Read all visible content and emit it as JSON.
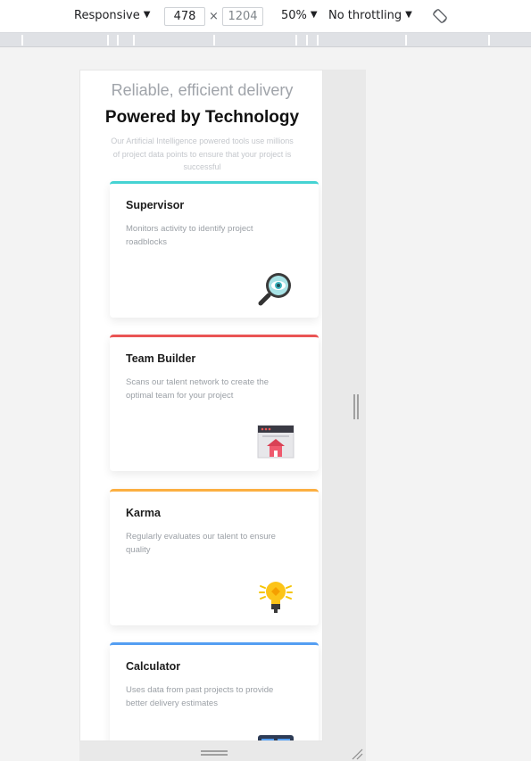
{
  "devtools": {
    "device_mode": "Responsive",
    "width": "478",
    "height": "1204",
    "times_symbol": "×",
    "zoom": "50%",
    "throttling": "No throttling",
    "caret": "▼"
  },
  "hero": {
    "subtitle": "Reliable, efficient delivery",
    "title": "Powered by Technology",
    "description": "Our Artificial Intelligence powered tools use millions of project data points to ensure that your project is successful"
  },
  "cards": [
    {
      "title": "Supervisor",
      "description": "Monitors activity to identify project roadblocks",
      "accent": "#45d3d3",
      "icon": "magnifier-eye-icon"
    },
    {
      "title": "Team Builder",
      "description": "Scans our talent network to create the optimal team for your project",
      "accent": "#ea5454",
      "icon": "browser-team-icon"
    },
    {
      "title": "Karma",
      "description": "Regularly evaluates our talent to ensure quality",
      "accent": "#fcaf41",
      "icon": "lightbulb-icon"
    },
    {
      "title": "Calculator",
      "description": "Uses data from past projects to provide better delivery estimates",
      "accent": "#549ef2",
      "icon": "calculator-icon"
    }
  ]
}
